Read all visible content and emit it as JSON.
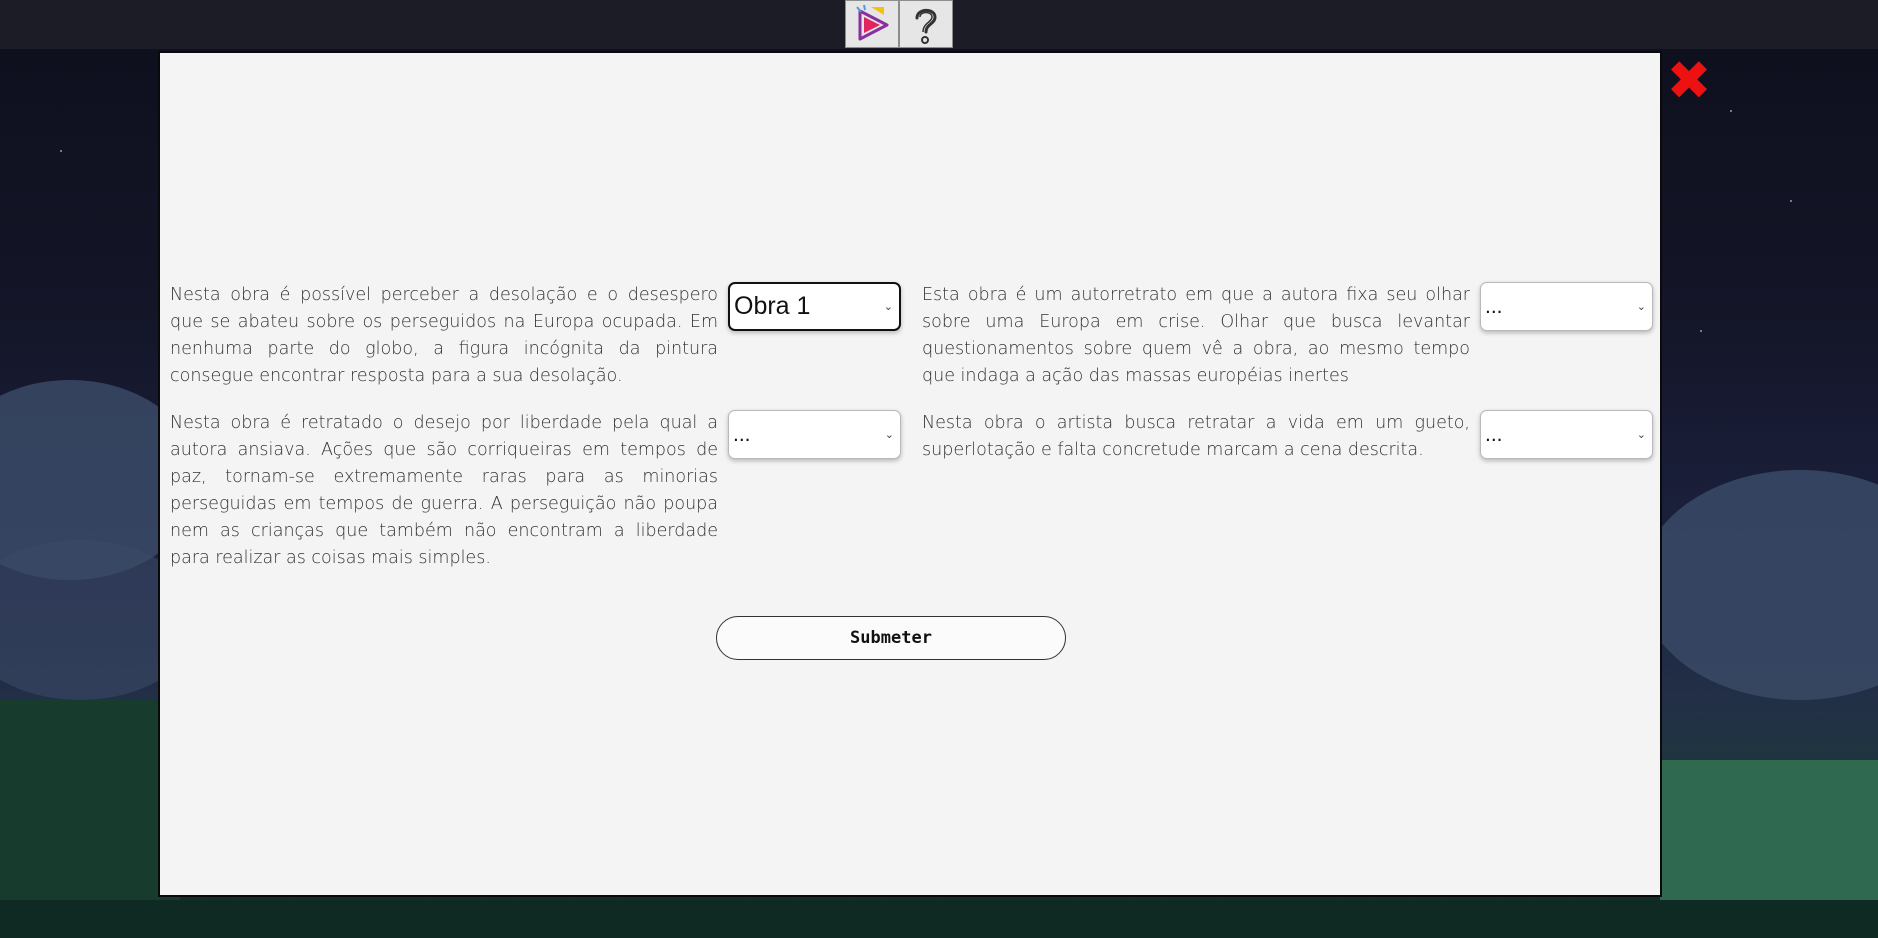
{
  "toolbar": {
    "icons": [
      "video-play-icon",
      "help-question-icon"
    ]
  },
  "close_icon": "close-x-icon",
  "questions": [
    {
      "text": "Nesta obra é possível perceber a desolação e o desespero que se abateu sobre os perseguidos na Europa ocupada. Em nenhuma parte do globo, a figura incógnita da pintura consegue encontrar resposta para a sua desolação.",
      "selected": "Obra 1"
    },
    {
      "text": "Esta obra é um autorretrato em que a autora fixa seu olhar sobre uma Europa em crise. Olhar que busca levantar questionamentos sobre quem vê a obra, ao mesmo tempo que indaga a ação das massas européias inertes",
      "selected": "..."
    },
    {
      "text": "Nesta obra é retratado o desejo por liberdade pela qual a autora ansiava. Ações que são corriqueiras em tempos de paz, tornam-se extremamente raras para as minorias perseguidas em tempos de guerra. A perseguição não poupa nem as crianças que também não encontram a liberdade para realizar as coisas mais simples.",
      "selected": "..."
    },
    {
      "text": "Nesta obra o artista busca retratar a vida em um gueto, superlotação e falta concretude marcam a cena descrita.",
      "selected": "..."
    }
  ],
  "submit_label": "Submeter",
  "colors": {
    "close": "#ee1111",
    "modal_bg": "#f4f4f4",
    "topbar": "#1b1c25"
  }
}
